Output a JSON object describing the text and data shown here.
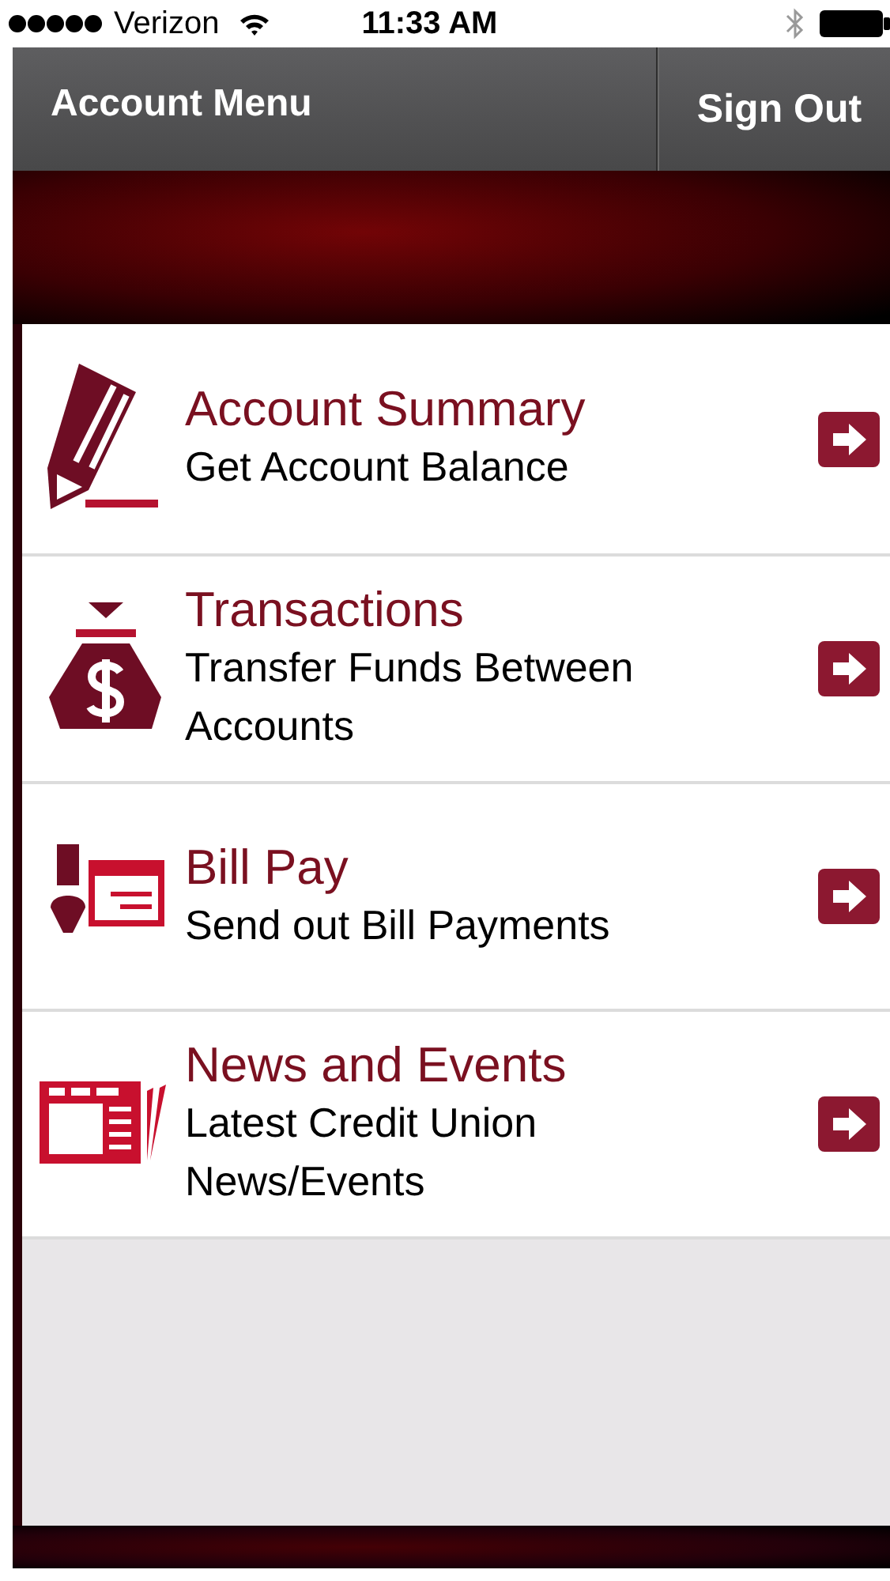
{
  "status_bar": {
    "carrier": "Verizon",
    "time": "11:33 AM"
  },
  "nav_bar": {
    "title": "Account Menu",
    "button": "Sign Out"
  },
  "menu": [
    {
      "kind": "pencil",
      "title": "Account Summary",
      "subtitle": "Get Account Balance"
    },
    {
      "kind": "moneybag",
      "title": "Transactions",
      "subtitle": "Transfer Funds Between Accounts"
    },
    {
      "kind": "pen",
      "title": "Bill Pay",
      "subtitle": "Send out Bill Payments"
    },
    {
      "kind": "newspaper",
      "title": "News and Events",
      "subtitle": "Latest Credit Union News/Events"
    }
  ]
}
